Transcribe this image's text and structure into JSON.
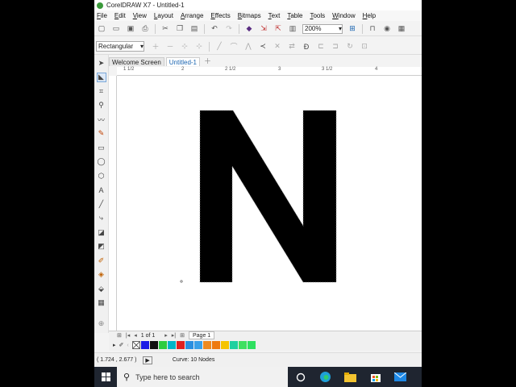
{
  "window": {
    "title": "CorelDRAW X7 - Untitled-1"
  },
  "menu": [
    "File",
    "Edit",
    "View",
    "Layout",
    "Arrange",
    "Effects",
    "Bitmaps",
    "Text",
    "Table",
    "Tools",
    "Window",
    "Help"
  ],
  "toolbar": {
    "zoom": "200%"
  },
  "property_bar": {
    "shape_type": "Rectangular"
  },
  "tabs": {
    "welcome": "Welcome Screen",
    "document": "Untitled-1"
  },
  "ruler": {
    "ticks": [
      "1 1/2",
      "2",
      "2 1/2",
      "3",
      "3 1/2",
      "4"
    ]
  },
  "canvas": {
    "letter": "N",
    "letter_color": "#000000",
    "node_count": 10
  },
  "page_nav": {
    "count": "1 of 1",
    "page_tab": "Page 1"
  },
  "palette": {
    "colors": [
      "#1a1ae6",
      "#111111",
      "#2ecc40",
      "#00b5c8",
      "#e02020",
      "#2a8fe0",
      "#3aa0e8",
      "#ee8a20",
      "#ee7a10",
      "#f5c400",
      "#20d0a0",
      "#3fe060",
      "#2ee060"
    ]
  },
  "status": {
    "coordinates": "( 1.724 , 2.677 )",
    "object_info": "Curve: 10 Nodes"
  },
  "taskbar": {
    "search_placeholder": "Type here to search"
  }
}
